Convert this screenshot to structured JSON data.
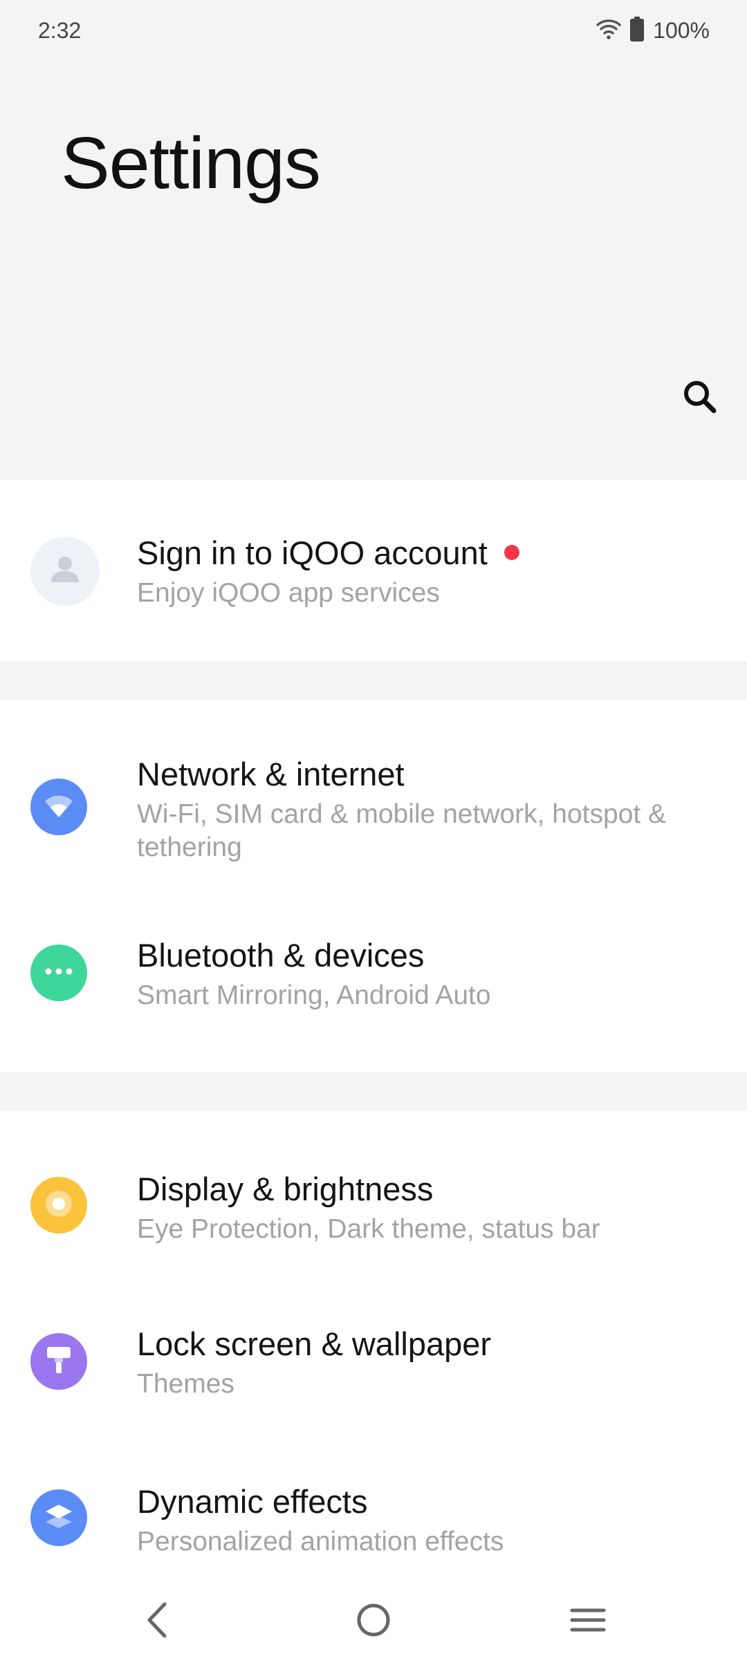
{
  "status_bar": {
    "time": "2:32",
    "battery": "100%",
    "wifi_icon": "wifi-icon",
    "battery_icon": "battery-icon"
  },
  "header": {
    "title": "Settings",
    "search_icon": "search-icon"
  },
  "account": {
    "title": "Sign in to iQOO account",
    "subtitle": "Enjoy iQOO app services",
    "icon": "person-icon",
    "notification_color": "#f4364c"
  },
  "items": [
    {
      "title": "Network & internet",
      "subtitle": "Wi-Fi, SIM card & mobile network, hotspot & tethering",
      "icon": "wifi-icon",
      "color": "#5b8cf5"
    },
    {
      "title": "Bluetooth & devices",
      "subtitle": "Smart Mirroring, Android Auto",
      "icon": "more-dots-icon",
      "color": "#3fd69a"
    },
    {
      "title": "Display & brightness",
      "subtitle": "Eye Protection, Dark theme, status bar",
      "icon": "brightness-icon",
      "color": "#fbc23b"
    },
    {
      "title": "Lock screen & wallpaper",
      "subtitle": "Themes",
      "icon": "paint-roller-icon",
      "color": "#9a76ef"
    },
    {
      "title": "Dynamic effects",
      "subtitle": "Personalized animation effects",
      "icon": "layers-icon",
      "color": "#5b8cf5"
    }
  ],
  "navbar": {
    "back_icon": "back-icon",
    "home_icon": "home-icon",
    "menu_icon": "menu-icon"
  }
}
